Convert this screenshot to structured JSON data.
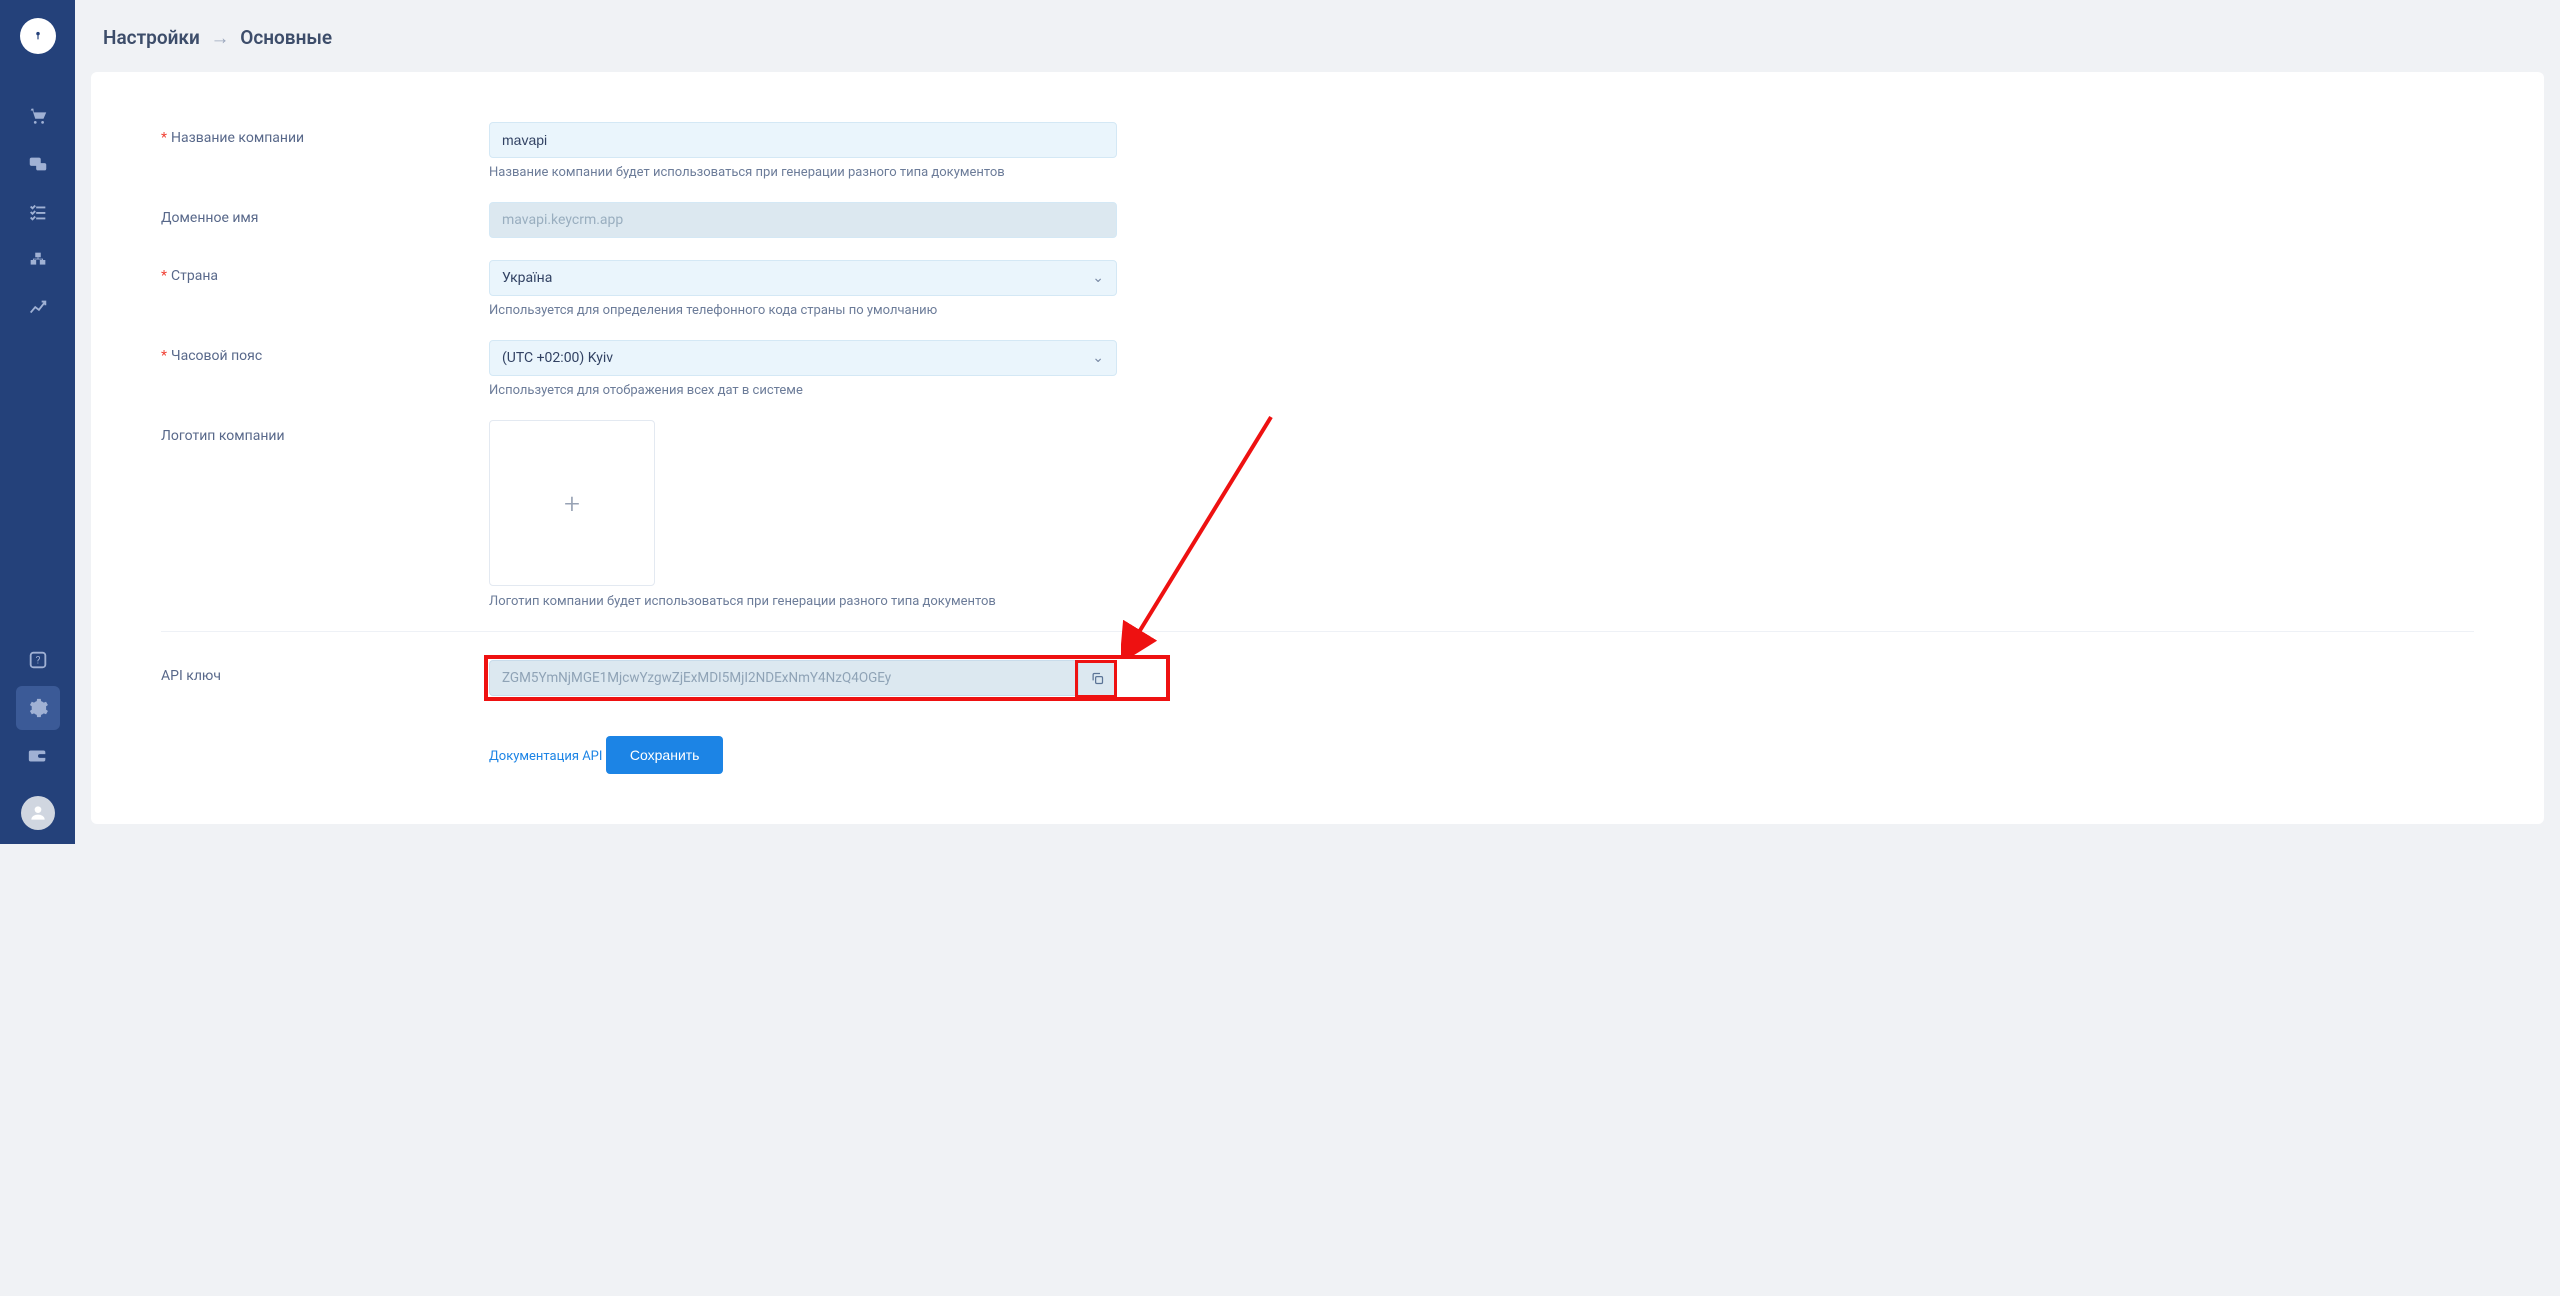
{
  "breadcrumb": {
    "root": "Настройки",
    "current": "Основные"
  },
  "form": {
    "company_name": {
      "label": "Название компании",
      "value": "mavapi",
      "help": "Название компании будет использоваться при генерации разного типа документов"
    },
    "domain": {
      "label": "Доменное имя",
      "value": "mavapi.keycrm.app"
    },
    "country": {
      "label": "Страна",
      "value": "Україна",
      "help": "Используется для определения телефонного кода страны по умолчанию"
    },
    "timezone": {
      "label": "Часовой пояс",
      "value": "(UTC +02:00) Kyiv",
      "help": "Используется для отображения всех дат в системе"
    },
    "logo": {
      "label": "Логотип компании",
      "help": "Логотип компании будет использоваться при генерации разного типа документов"
    },
    "api": {
      "label": "API ключ",
      "value": "ZGM5YmNjMGE1MjcwYzgwZjExMDI5MjI2NDExNmY4NzQ4OGEy",
      "doc_link": "Документация API"
    },
    "save": "Сохранить"
  },
  "colors": {
    "sidebar": "#24417a",
    "accent": "#1c84e5",
    "danger": "#e11"
  }
}
